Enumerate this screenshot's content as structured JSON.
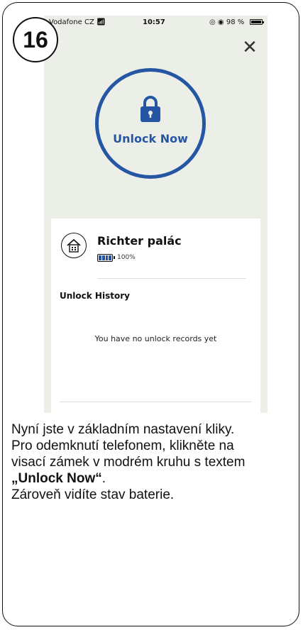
{
  "step": {
    "number": "16"
  },
  "status_bar": {
    "carrier": "Vodafone CZ",
    "time": "10:57",
    "battery": "98 %"
  },
  "icons": {
    "close": "close-icon",
    "lock": "lock-icon",
    "home": "house-icon",
    "battery": "battery-icon",
    "wifi": "wifi-icon"
  },
  "unlock": {
    "label": "Unlock Now"
  },
  "lock_device": {
    "name": "Richter palác",
    "battery": "100%"
  },
  "history": {
    "title": "Unlock History",
    "empty_message": "You have no unlock records yet"
  },
  "caption": {
    "line1": "Nyní jste v základním nastavení kliky.",
    "line2": "Pro odemknutí telefonem, klikněte na",
    "line3": "visací zámek v modrém kruhu s textem",
    "line4_bold": "„Unlock Now“",
    "line4_end": ".",
    "line5": "Zároveň vidíte stav baterie."
  },
  "colors": {
    "accent": "#2456a4",
    "screen_bg": "#ecefe7"
  }
}
